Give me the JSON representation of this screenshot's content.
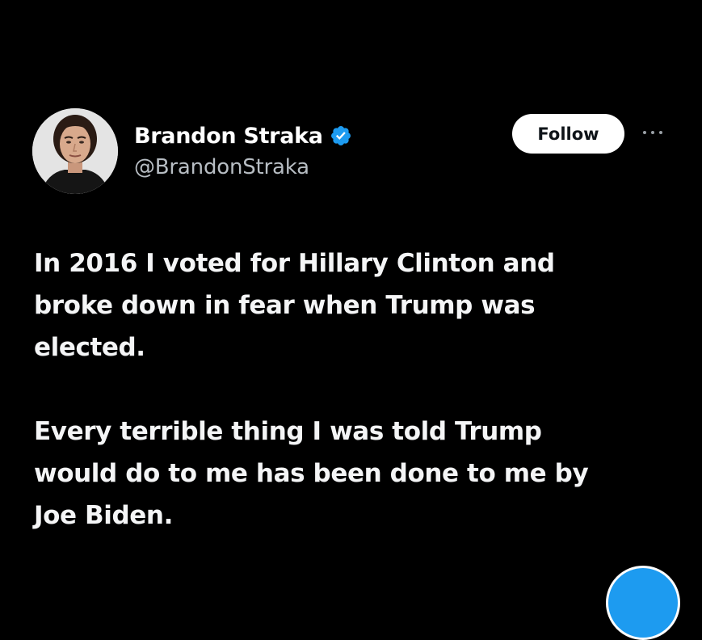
{
  "author": {
    "display_name": "Brandon Straka",
    "handle": "@BrandonStraka",
    "verified_icon": "verified-badge-icon",
    "avatar_icon": "profile-photo"
  },
  "actions": {
    "follow_label": "Follow",
    "more_icon": "more-options-icon"
  },
  "tweet": {
    "paragraphs": [
      "In 2016 I voted for Hillary Clinton and\nbroke down in fear when Trump was\nelected.",
      "Every terrible thing I was told Trump\nwould do to me has been done to me by\nJoe Biden."
    ]
  },
  "colors": {
    "background": "#000000",
    "text": "#f4f5f6",
    "handle": "#b7bdc3",
    "verified": "#1d9bf0",
    "follow_bg": "#ffffff",
    "follow_text": "#0f1419"
  },
  "floating_button_icon": "compose-icon"
}
